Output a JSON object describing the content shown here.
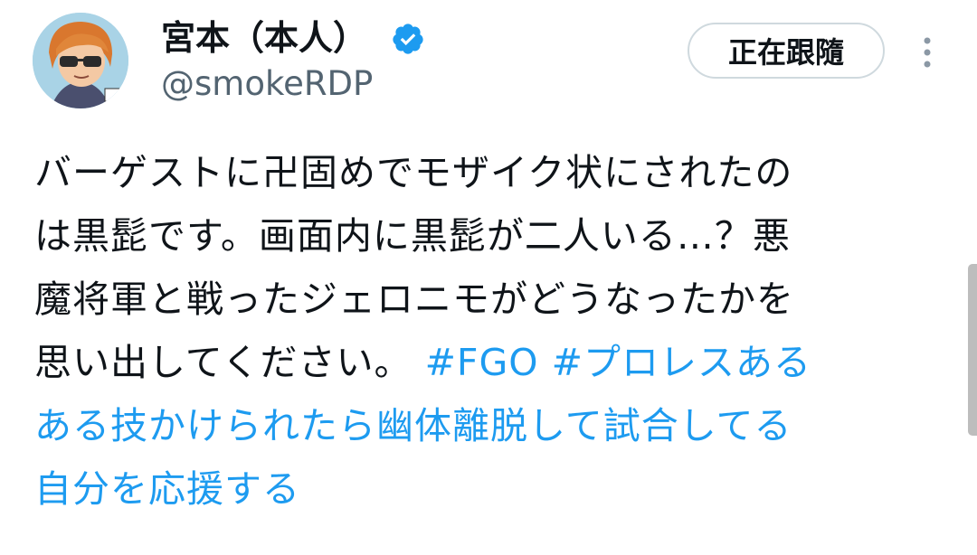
{
  "author": {
    "display_name": "宮本（本人）",
    "handle": "@smokeRDP",
    "verified": true
  },
  "actions": {
    "follow_label": "正在跟隨",
    "more_icon": "more-vertical-icon"
  },
  "tweet": {
    "line1": "バーゲストに卍固めでモザイク状にされたの",
    "line2": "は黒髭です。画面内に黒髭が二人いる…？悪",
    "line3": "魔将軍と戦ったジェロニモがどうなったかを",
    "line4_text": "思い出してください。 ",
    "hashtag1": "#FGO",
    "hashtag2_part1": " #プロレスある",
    "hashtag2_part2": "ある技かけられたら幽体離脱して試合してる",
    "hashtag2_part3": "自分を応援する"
  },
  "colors": {
    "hashtag": "#1d9bf0",
    "verified_badge": "#1d9bf0",
    "handle": "#536471"
  }
}
